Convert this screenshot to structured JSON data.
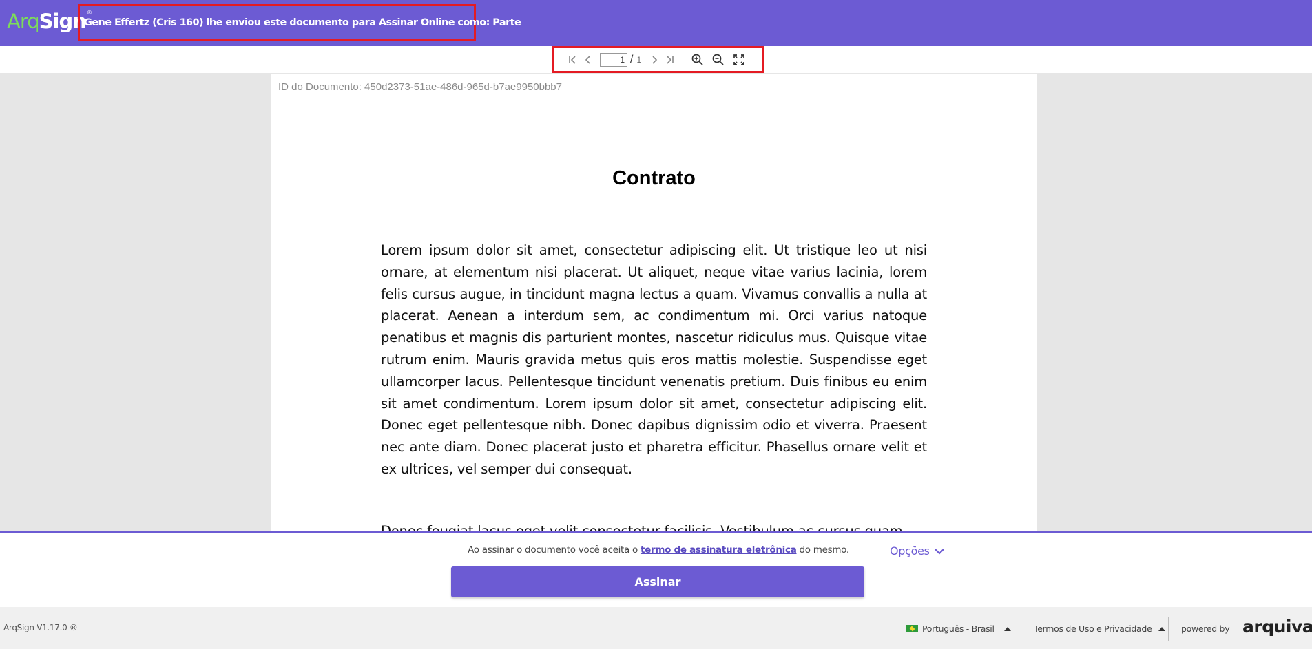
{
  "header": {
    "logo_arq": "Arq",
    "logo_sign": "Sign",
    "logo_mark": "®",
    "message": "Gene Effertz (Cris 160) lhe enviou este documento para Assinar Online como: Parte",
    "bg_color": "#6c5bd3"
  },
  "toolbar": {
    "first_page_icon": "first-page-icon",
    "prev_page_icon": "chevron-left-icon",
    "current_page": "1",
    "separator": "/",
    "total_pages": "1",
    "next_page_icon": "chevron-right-icon",
    "last_page_icon": "last-page-icon",
    "zoom_in_icon": "zoom-in-icon",
    "zoom_out_icon": "zoom-out-icon",
    "fullscreen_icon": "fullscreen-icon"
  },
  "document": {
    "id_label": "ID do Documento: 450d2373-51ae-486d-965d-b7ae9950bbb7",
    "title": "Contrato",
    "paragraph1": "Lorem ipsum dolor sit amet, consectetur adipiscing elit. Ut tristique leo ut nisi ornare, at elementum nisi placerat. Ut aliquet, neque vitae varius lacinia, lorem felis cursus augue, in tincidunt magna lectus a quam. Vivamus convallis a nulla at placerat. Aenean a interdum sem, ac condimentum mi. Orci varius natoque penatibus et magnis dis parturient montes, nascetur ridiculus mus. Quisque vitae rutrum enim. Mauris gravida metus quis eros mattis molestie. Suspendisse eget ullamcorper lacus. Pellentesque tincidunt venenatis pretium. Duis finibus eu enim sit amet condimentum. Lorem ipsum dolor sit amet, consectetur adipiscing elit. Donec eget pellentesque nibh. Donec dapibus dignissim odio et viverra. Praesent nec ante diam. Donec placerat justo et pharetra efficitur. Phasellus ornare velit et ex ultrices, vel semper dui consequat.",
    "paragraph2": "Donec feugiat lacus eget velit consectetur facilisis. Vestibulum ac cursus quam"
  },
  "sign_panel": {
    "terms_prefix": "Ao assinar o documento você aceita o ",
    "terms_link": "termo de assinatura eletrônica",
    "terms_suffix": " do mesmo.",
    "options_label": "Opções",
    "sign_button": "Assinar"
  },
  "footer": {
    "version": "ArqSign V1.17.0 ®",
    "language": "Português - Brasil",
    "terms": "Termos de Uso e Privacidade",
    "powered_by": "powered by",
    "brand": "arquivar"
  }
}
